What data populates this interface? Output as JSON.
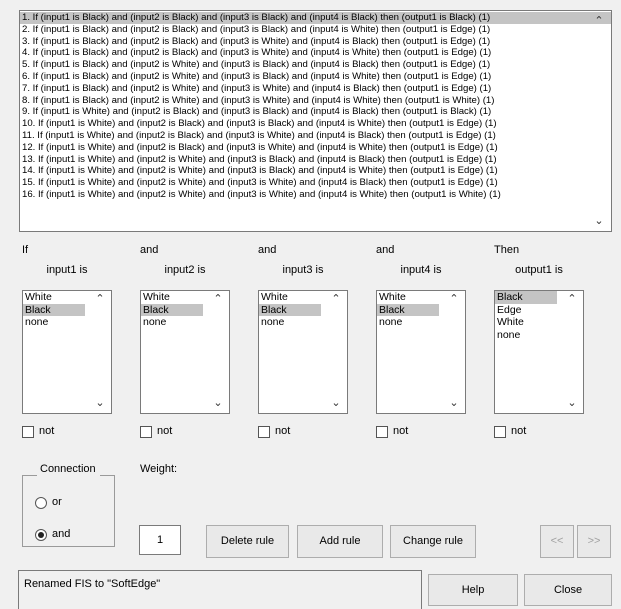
{
  "rules": [
    "1. If (input1 is Black) and (input2 is Black) and (input3 is Black) and (input4 is Black) then (output1 is Black) (1)",
    "2. If (input1 is Black) and (input2 is Black) and (input3 is Black) and (input4 is White) then (output1 is Edge) (1)",
    "3. If (input1 is Black) and (input2 is Black) and (input3 is White) and (input4 is Black) then (output1 is Edge) (1)",
    "4. If (input1 is Black) and (input2 is Black) and (input3 is White) and (input4 is White) then (output1 is Edge) (1)",
    "5. If (input1 is Black) and (input2 is White) and (input3 is Black) and (input4 is Black) then (output1 is Edge) (1)",
    "6. If (input1 is Black) and (input2 is White) and (input3 is Black) and (input4 is White) then (output1 is Edge) (1)",
    "7. If (input1 is Black) and (input2 is White) and (input3 is White) and (input4 is Black) then (output1 is Edge) (1)",
    "8. If (input1 is Black) and (input2 is White) and (input3 is White) and (input4 is White) then (output1 is White) (1)",
    "9. If (input1 is White) and (input2 is Black) and (input3 is Black) and (input4 is Black) then (output1 is Black) (1)",
    "10. If (input1 is White) and (input2 is Black) and (input3 is Black) and (input4 is White) then (output1 is Edge) (1)",
    "11. If (input1 is White) and (input2 is Black) and (input3 is White) and (input4 is Black) then (output1 is Edge) (1)",
    "12. If (input1 is White) and (input2 is Black) and (input3 is White) and (input4 is White) then (output1 is Edge) (1)",
    "13. If (input1 is White) and (input2 is White) and (input3 is Black) and (input4 is Black) then (output1 is Edge) (1)",
    "14. If (input1 is White) and (input2 is White) and (input3 is Black) and (input4 is White) then (output1 is Edge) (1)",
    "15. If (input1 is White) and (input2 is White) and (input3 is White) and (input4 is Black) then (output1 is Edge) (1)",
    "16. If (input1 is White) and (input2 is White) and (input3 is White) and (input4 is White) then (output1 is White) (1)"
  ],
  "selected_rule_index": 0,
  "columns": [
    {
      "connector": "If",
      "variable": "input1 is",
      "options": [
        "White",
        "Black",
        "none"
      ],
      "selected": 1,
      "not_label": "not"
    },
    {
      "connector": "and",
      "variable": "input2 is",
      "options": [
        "White",
        "Black",
        "none"
      ],
      "selected": 1,
      "not_label": "not"
    },
    {
      "connector": "and",
      "variable": "input3 is",
      "options": [
        "White",
        "Black",
        "none"
      ],
      "selected": 1,
      "not_label": "not"
    },
    {
      "connector": "and",
      "variable": "input4 is",
      "options": [
        "White",
        "Black",
        "none"
      ],
      "selected": 1,
      "not_label": "not"
    },
    {
      "connector": "Then",
      "variable": "output1 is",
      "options": [
        "Black",
        "Edge",
        "White",
        "none"
      ],
      "selected": 0,
      "not_label": "not"
    }
  ],
  "connection": {
    "title": "Connection",
    "or_label": "or",
    "and_label": "and",
    "selected": "and"
  },
  "weight": {
    "label": "Weight:",
    "value": "1"
  },
  "buttons": {
    "delete": "Delete rule",
    "add": "Add rule",
    "change": "Change rule",
    "prev": "<<",
    "next": ">>",
    "help": "Help",
    "close": "Close"
  },
  "status": "Renamed FIS to \"SoftEdge\"",
  "icons": {
    "scroll_up": "chevron-up-icon",
    "scroll_down": "chevron-down-icon"
  }
}
